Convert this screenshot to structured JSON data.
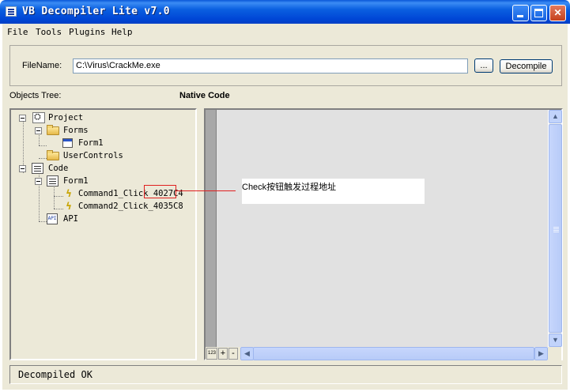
{
  "window": {
    "title": "VB Decompiler Lite v7.0"
  },
  "menu": {
    "items": [
      "File",
      "Tools",
      "Plugins",
      "Help"
    ]
  },
  "file": {
    "label": "FileName:",
    "value": "C:\\Virus\\CrackMe.exe",
    "browse_label": "...",
    "decompile_label": "Decompile"
  },
  "panels": {
    "objects_label": "Objects Tree:",
    "code_label": "Native Code"
  },
  "tree": {
    "project": "Project",
    "forms": "Forms",
    "form1": "Form1",
    "usercontrols": "UserControls",
    "code": "Code",
    "code_form1": "Form1",
    "cmd1": "Command1_Click_",
    "cmd1_addr": "4027C4",
    "cmd2": "Command2_Click_4035C8",
    "api": "API"
  },
  "annotation": {
    "text": "Check按钮触发过程地址",
    "color": "#e02020"
  },
  "toolbar": {
    "num_button": "123",
    "plus": "+",
    "minus": "-"
  },
  "status": {
    "text": "Decompiled OK"
  }
}
